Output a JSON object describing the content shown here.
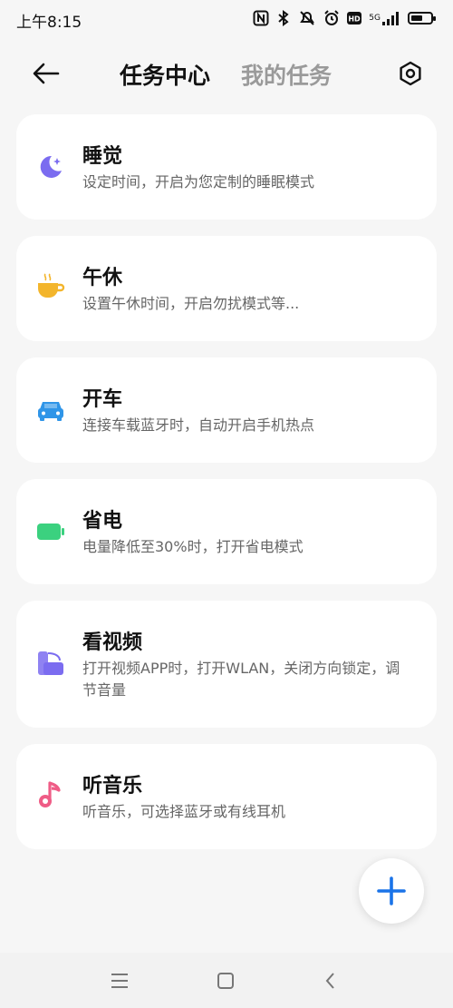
{
  "status_bar": {
    "time": "上午8:15",
    "network": "5G",
    "battery_level": 0.6
  },
  "header": {
    "back_icon": "back-arrow-icon",
    "tabs": [
      {
        "label": "任务中心",
        "active": true
      },
      {
        "label": "我的任务",
        "active": false
      }
    ],
    "settings_icon": "settings-hexagon-icon"
  },
  "tasks": [
    {
      "title": "睡觉",
      "description": "设定时间，开启为您定制的睡眠模式",
      "icon": "moon-star-icon",
      "color": "#7b6cf0"
    },
    {
      "title": "午休",
      "description": "设置午休时间，开启勿扰模式等...",
      "icon": "tea-cup-icon",
      "color": "#f3b52c"
    },
    {
      "title": "开车",
      "description": "连接车载蓝牙时，自动开启手机热点",
      "icon": "car-icon",
      "color": "#2f95e8"
    },
    {
      "title": "省电",
      "description": "电量降低至30%时，打开省电模式",
      "icon": "battery-icon",
      "color": "#3bd17f"
    },
    {
      "title": "看视频",
      "description": "打开视频APP时，打开WLAN，关闭方向锁定，调节音量",
      "icon": "video-screen-icon",
      "color": "#7b6cf0"
    },
    {
      "title": "听音乐",
      "description": "听音乐，可选择蓝牙或有线耳机",
      "icon": "music-note-icon",
      "color": "#ef5c86"
    }
  ],
  "fab": {
    "icon": "plus-icon",
    "color": "#1a73e8"
  },
  "nav_bar": {
    "menu_icon": "menu-icon",
    "home_icon": "home-square-icon",
    "back_icon": "back-chevron-icon"
  }
}
